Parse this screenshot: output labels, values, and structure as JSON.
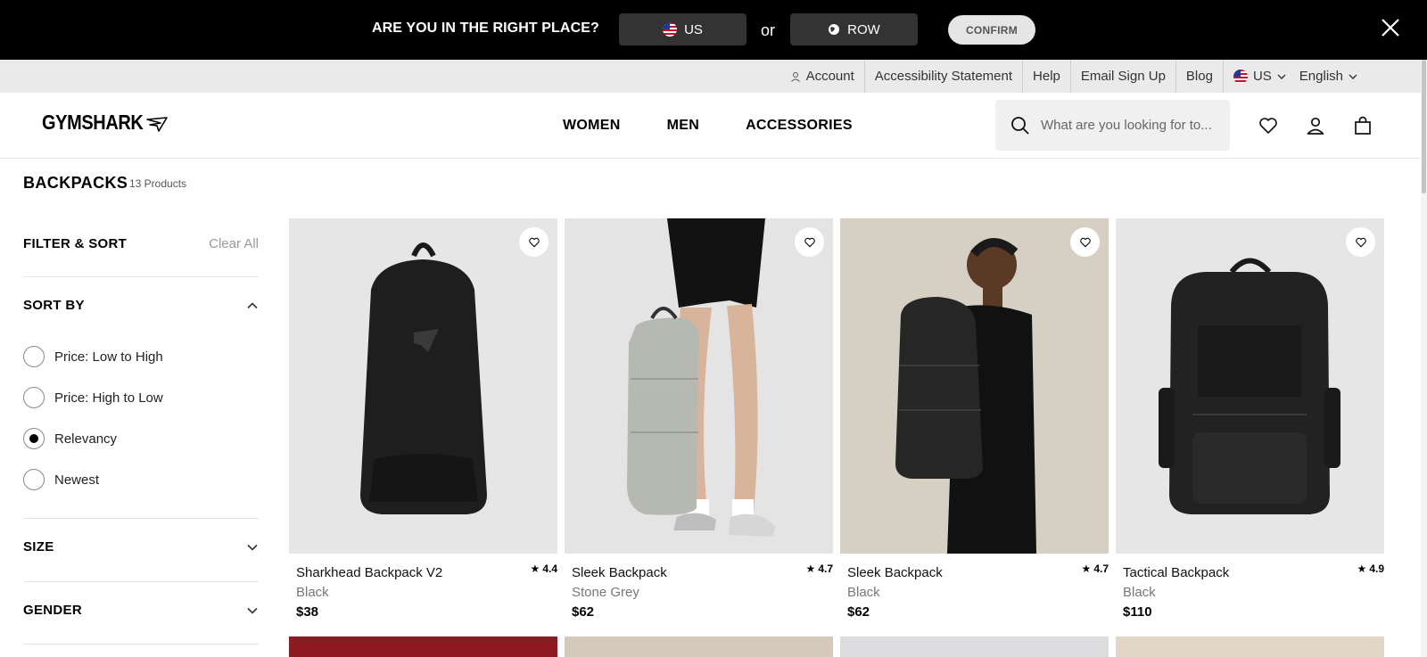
{
  "region_banner": {
    "question": "ARE YOU IN THE RIGHT PLACE?",
    "option_us": "US",
    "or_text": "or",
    "option_row": "ROW",
    "confirm_label": "CONFIRM"
  },
  "utility_nav": {
    "account": "Account",
    "accessibility": "Accessibility Statement",
    "help": "Help",
    "email_signup": "Email Sign Up",
    "blog": "Blog",
    "country": "US",
    "language": "English"
  },
  "header": {
    "logo_text": "GYMSHARK",
    "nav": [
      "WOMEN",
      "MEN",
      "ACCESSORIES"
    ],
    "search_placeholder": "What are you looking for to..."
  },
  "page": {
    "title": "BACKPACKS",
    "count": "13 Products"
  },
  "sidebar": {
    "filter_title": "FILTER & SORT",
    "clear_all": "Clear All",
    "sort_title": "SORT BY",
    "sort_options": [
      "Price: Low to High",
      "Price: High to Low",
      "Relevancy",
      "Newest"
    ],
    "sort_selected": "Relevancy",
    "size_title": "SIZE",
    "gender_title": "GENDER"
  },
  "products": [
    {
      "name": "Sharkhead Backpack V2",
      "color": "Black",
      "price": "$38",
      "rating": "4.4"
    },
    {
      "name": "Sleek Backpack",
      "color": "Stone Grey",
      "price": "$62",
      "rating": "4.7"
    },
    {
      "name": "Sleek Backpack",
      "color": "Black",
      "price": "$62",
      "rating": "4.7"
    },
    {
      "name": "Tactical Backpack",
      "color": "Black",
      "price": "$110",
      "rating": "4.9"
    }
  ],
  "colors": {
    "banner_bg": "#000000",
    "utility_bg": "#eaeaea",
    "accent": "#000000"
  }
}
